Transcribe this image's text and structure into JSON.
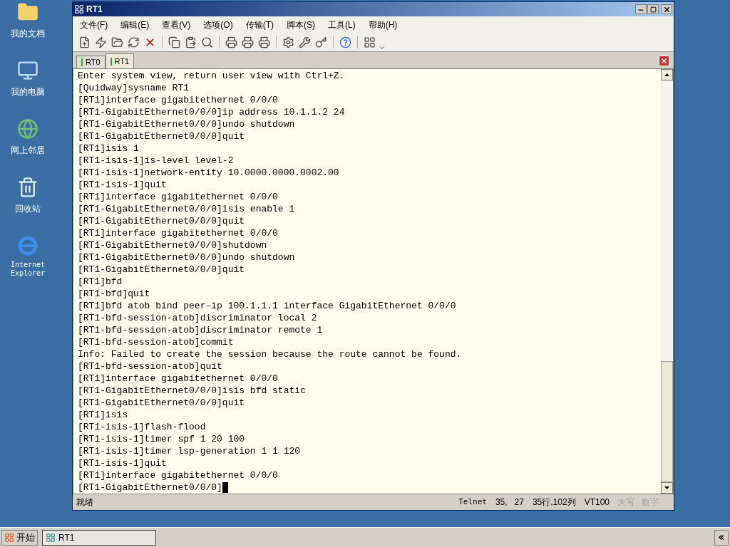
{
  "desktop_icons": [
    {
      "label": "我的文档",
      "kind": "folder"
    },
    {
      "label": "我的电脑",
      "kind": "computer"
    },
    {
      "label": "网上邻居",
      "kind": "network"
    },
    {
      "label": "回收站",
      "kind": "recycle"
    },
    {
      "label": "Internet Explorer",
      "kind": "browser"
    }
  ],
  "window": {
    "title": "RT1"
  },
  "menu": [
    "文件(F)",
    "编辑(E)",
    "查看(V)",
    "选项(O)",
    "传输(T)",
    "脚本(S)",
    "工具(L)",
    "帮助(H)"
  ],
  "tabs": [
    {
      "label": "RT0",
      "selected": false
    },
    {
      "label": "RT1",
      "selected": true
    }
  ],
  "terminal_lines": [
    "Enter system view, return user view with Ctrl+Z.",
    "[Quidway]sysname RT1",
    "[RT1]interface gigabitethernet 0/0/0",
    "[RT1-GigabitEthernet0/0/0]ip address 10.1.1.2 24",
    "[RT1-GigabitEthernet0/0/0]undo shutdown",
    "[RT1-GigabitEthernet0/0/0]quit",
    "[RT1]isis 1",
    "[RT1-isis-1]is-level level-2",
    "[RT1-isis-1]network-entity 10.0000.0000.0002.00",
    "[RT1-isis-1]quit",
    "[RT1]interface gigabitethernet 0/0/0",
    "[RT1-GigabitEthernet0/0/0]isis enable 1",
    "[RT1-GigabitEthernet0/0/0]quit",
    "[RT1]interface gigabitethernet 0/0/0",
    "[RT1-GigabitEthernet0/0/0]shutdown",
    "[RT1-GigabitEthernet0/0/0]undo shutdown",
    "[RT1-GigabitEthernet0/0/0]quit",
    "[RT1]bfd",
    "[RT1-bfd]quit",
    "[RT1]bfd atob bind peer-ip 100.1.1.1 interface GigabitEthernet 0/0/0",
    "[RT1-bfd-session-atob]discriminator local 2",
    "[RT1-bfd-session-atob]discriminator remote 1",
    "[RT1-bfd-session-atob]commit",
    "Info: Failed to create the session because the route cannot be found.",
    "[RT1-bfd-session-atob]quit",
    "[RT1]interface gigabitethernet 0/0/0",
    "[RT1-GigabitEthernet0/0/0]isis bfd static",
    "[RT1-GigabitEthernet0/0/0]quit",
    "[RT1]isis",
    "[RT1-isis-1]flash-flood",
    "[RT1-isis-1]timer spf 1 20 100",
    "[RT1-isis-1]timer lsp-generation 1 1 120",
    "[RT1-isis-1]quit",
    "[RT1]interface gigabitethernet 0/0/0",
    "[RT1-GigabitEthernet0/0/0]"
  ],
  "status_bar": {
    "message": "就绪",
    "protocol": "Telnet",
    "position": "35,   27",
    "size": "35行,102列",
    "emulation": "VT100",
    "indicators": [
      {
        "label": "大写",
        "disabled": true
      },
      {
        "label": "数字",
        "disabled": true
      }
    ]
  },
  "taskbar": {
    "start": "开始",
    "tasks": [
      {
        "label": "RT1",
        "selected": true
      }
    ]
  }
}
